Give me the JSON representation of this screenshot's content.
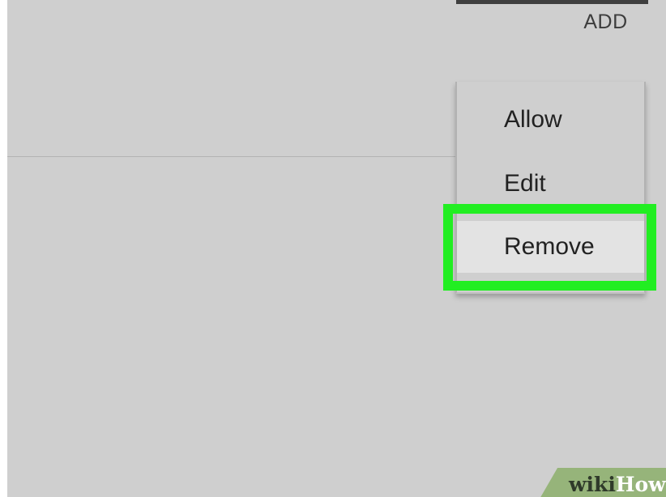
{
  "header": {
    "add_label": "ADD"
  },
  "context_menu": {
    "items": [
      {
        "label": "Allow"
      },
      {
        "label": "Edit"
      },
      {
        "label": "Remove",
        "highlighted": true
      }
    ]
  },
  "highlight": {
    "color": "#22ee22"
  },
  "watermark": {
    "part1": "wiki",
    "part2": "How"
  },
  "colors": {
    "panel_background": "#cfcfcf",
    "selected_item_background": "#e3e3e3",
    "watermark_band": "#96b47a"
  }
}
